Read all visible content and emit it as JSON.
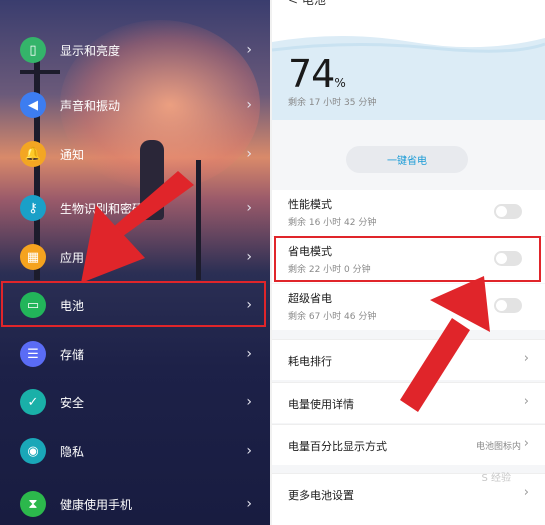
{
  "left_panel": {
    "items": [
      {
        "label": "显示和亮度",
        "icon": "display-brightness-icon",
        "color": "#34b46a",
        "glyph": "▯"
      },
      {
        "label": "声音和振动",
        "icon": "speaker-icon",
        "color": "#3d7df0",
        "glyph": "◀"
      },
      {
        "label": "通知",
        "icon": "bell-icon",
        "color": "#f3a623",
        "glyph": "🔔"
      },
      {
        "label": "生物识别和密码",
        "icon": "key-icon",
        "color": "#1aa0c8",
        "glyph": "⚷"
      },
      {
        "label": "应用",
        "icon": "apps-grid-icon",
        "color": "#f5a31f",
        "glyph": "▦"
      },
      {
        "label": "电池",
        "icon": "battery-icon",
        "color": "#22b55a",
        "glyph": "▭"
      },
      {
        "label": "存储",
        "icon": "storage-icon",
        "color": "#5a6cf5",
        "glyph": "☰"
      },
      {
        "label": "安全",
        "icon": "shield-check-icon",
        "color": "#1ab0a8",
        "glyph": "✓"
      },
      {
        "label": "隐私",
        "icon": "privacy-shield-icon",
        "color": "#1aa7b8",
        "glyph": "◉"
      },
      {
        "label": "健康使用手机",
        "icon": "hourglass-icon",
        "color": "#2cb84c",
        "glyph": "⧗"
      }
    ],
    "chevron": "›"
  },
  "right_panel": {
    "topbar_text": "< 电池",
    "battery_percent": "74",
    "percent_sign": "%",
    "remaining": "剩余 17 小时 35 分钟",
    "one_key_save": "一键省电",
    "modes": [
      {
        "title": "性能模式",
        "sub": "剩余 16 小时 42 分钟",
        "on": false
      },
      {
        "title": "省电模式",
        "sub": "剩余 22 小时 0 分钟",
        "on": false
      },
      {
        "title": "超级省电",
        "sub": "剩余 67 小时 46 分钟",
        "on": false
      }
    ],
    "links": [
      {
        "title": "耗电排行",
        "value": ""
      },
      {
        "title": "电量使用详情",
        "value": ""
      },
      {
        "title": "电量百分比显示方式",
        "value": "电池图标内"
      },
      {
        "title": "更多电池设置",
        "value": ""
      }
    ],
    "chevron": "›",
    "watermark": "S 经验"
  },
  "colors": {
    "highlight": "#e0252a",
    "accent": "#1a9bd6"
  }
}
